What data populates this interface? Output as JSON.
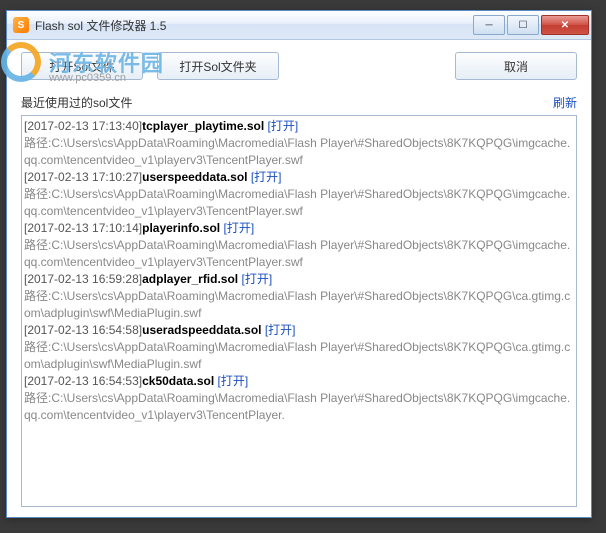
{
  "window": {
    "title": "Flash sol 文件修改器 1.5"
  },
  "watermark": {
    "brand": "河东软件园",
    "url": "www.pc0359.cn"
  },
  "buttons": {
    "open_file": "打开Sol文件",
    "open_folder": "打开Sol文件夹",
    "cancel": "取消"
  },
  "recent": {
    "label": "最近使用过的sol文件",
    "refresh": "刷新",
    "open_label": "[打开]",
    "path_prefix": "路径:",
    "items": [
      {
        "timestamp": "[2017-02-13 17:13:40]",
        "filename": "tcplayer_playtime.sol",
        "path": "C:\\Users\\cs\\AppData\\Roaming\\Macromedia\\Flash Player\\#SharedObjects\\8K7KQPQG\\imgcache.qq.com\\tencentvideo_v1\\playerv3\\TencentPlayer.swf"
      },
      {
        "timestamp": "[2017-02-13 17:10:27]",
        "filename": "userspeeddata.sol",
        "path": "C:\\Users\\cs\\AppData\\Roaming\\Macromedia\\Flash Player\\#SharedObjects\\8K7KQPQG\\imgcache.qq.com\\tencentvideo_v1\\playerv3\\TencentPlayer.swf"
      },
      {
        "timestamp": "[2017-02-13 17:10:14]",
        "filename": "playerinfo.sol",
        "path": "C:\\Users\\cs\\AppData\\Roaming\\Macromedia\\Flash Player\\#SharedObjects\\8K7KQPQG\\imgcache.qq.com\\tencentvideo_v1\\playerv3\\TencentPlayer.swf"
      },
      {
        "timestamp": "[2017-02-13 16:59:28]",
        "filename": "adplayer_rfid.sol",
        "path": "C:\\Users\\cs\\AppData\\Roaming\\Macromedia\\Flash Player\\#SharedObjects\\8K7KQPQG\\ca.gtimg.com\\adplugin\\swf\\MediaPlugin.swf"
      },
      {
        "timestamp": "[2017-02-13 16:54:58]",
        "filename": "useradspeeddata.sol",
        "path": "C:\\Users\\cs\\AppData\\Roaming\\Macromedia\\Flash Player\\#SharedObjects\\8K7KQPQG\\ca.gtimg.com\\adplugin\\swf\\MediaPlugin.swf"
      },
      {
        "timestamp": "[2017-02-13 16:54:53]",
        "filename": "ck50data.sol",
        "path": "C:\\Users\\cs\\AppData\\Roaming\\Macromedia\\Flash Player\\#SharedObjects\\8K7KQPQG\\imgcache.qq.com\\tencentvideo_v1\\playerv3\\TencentPlayer."
      }
    ]
  }
}
